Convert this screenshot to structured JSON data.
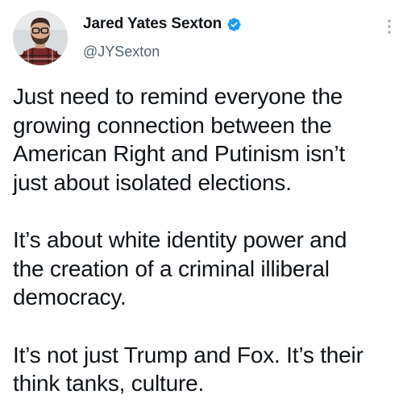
{
  "author": {
    "display_name": "Jared Yates Sexton",
    "handle": "@JYSexton",
    "verified": true,
    "verified_icon": "verified-badge-icon",
    "verified_color": "#1d9bf0"
  },
  "menu": {
    "icon": "more-vertical-icon"
  },
  "tweet": {
    "paragraphs": [
      "Just need to remind everyone the\ngrowing connection between the\nAmerican Right and Putinism isn’t\njust about isolated elections.",
      "It’s about white identity power and\nthe creation of a criminal illiberal\ndemocracy.",
      "It’s not just Trump and Fox. It’s their\nthink tanks, culture."
    ]
  },
  "colors": {
    "text": "#0f1419",
    "secondary": "#536471",
    "background": "#ffffff"
  }
}
